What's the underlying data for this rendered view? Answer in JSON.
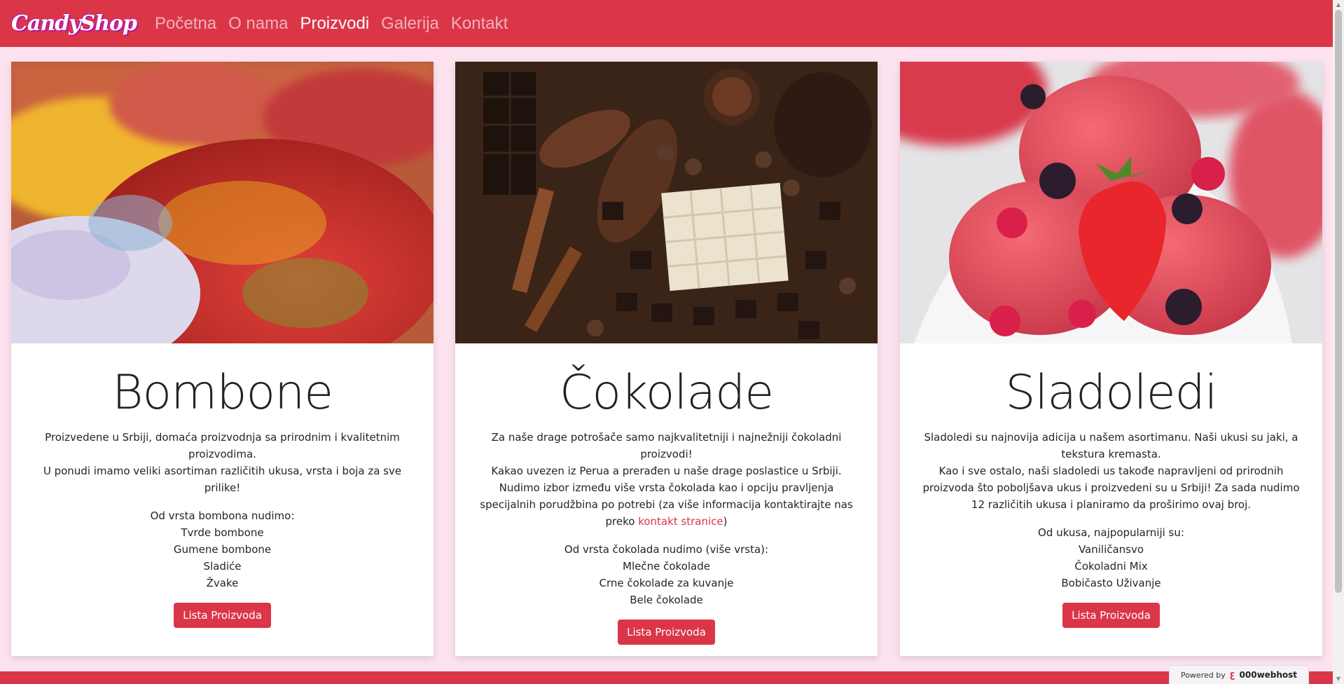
{
  "navbar": {
    "brand": "CandyShop",
    "links": [
      {
        "label": "Početna",
        "active": false
      },
      {
        "label": "O nama",
        "active": false
      },
      {
        "label": "Proizvodi",
        "active": true
      },
      {
        "label": "Galerija",
        "active": false
      },
      {
        "label": "Kontakt",
        "active": false
      }
    ]
  },
  "cards": [
    {
      "title": "Bombone",
      "text_1": "Proizvedene u Srbiji, domaća proizvodnja sa prirodnim i kvalitetnim proizvodima.",
      "text_2": "U ponudi imamo veliki asortiman različitih ukusa, vrsta i boja za sve prilike!",
      "list_intro": "Od vrsta bombona nudimo:",
      "items": [
        "Tvrde bombone",
        "Gumene bombone",
        "Sladiće",
        "Žvake"
      ],
      "button": "Lista Proizvoda"
    },
    {
      "title": "Čokolade",
      "text_1": "Za naše drage potrošače samo najkvalitetniji i najnežniji čokoladni proizvodi!",
      "text_2": "Kakao uvezen iz Perua a prerađen u naše drage poslastice u Srbiji.",
      "text_3": "Nudimo izbor između više vrsta čokolada kao i opciju pravljenja specijalnih porudžbina po potrebi (za više informacija kontaktirajte nas preko",
      "link": "kontakt stranice",
      "text_4": ")",
      "list_intro": "Od vrsta čokolada nudimo (više vrsta):",
      "items": [
        "Mlečne čokolade",
        "Crne čokolade za kuvanje",
        "Bele čokolade"
      ],
      "button": "Lista Proizvoda"
    },
    {
      "title": "Sladoledi",
      "text_1": "Sladoledi su najnovija adicija u našem asortimanu. Naši ukusi su jaki, a tekstura kremasta.",
      "text_2": "Kao i sve ostalo, naši sladoledi us takođe napravljeni od prirodnih proizvoda što poboljšava ukus i proizvedeni su u Srbiji! Za sada nudimo 12 različitih ukusa i planiramo da proširimo ovaj broj.",
      "list_intro": "Od ukusa, najpopularniji su:",
      "items": [
        "Vaniličansvo",
        "Čokoladni Mix",
        "Bobičasto Uživanje"
      ],
      "button": "Lista Proizvoda"
    }
  ],
  "badge": {
    "prefix": "Powered by",
    "name": "000webhost"
  },
  "colors": {
    "accent": "#db3648",
    "page_bg": "#fde2ef"
  }
}
